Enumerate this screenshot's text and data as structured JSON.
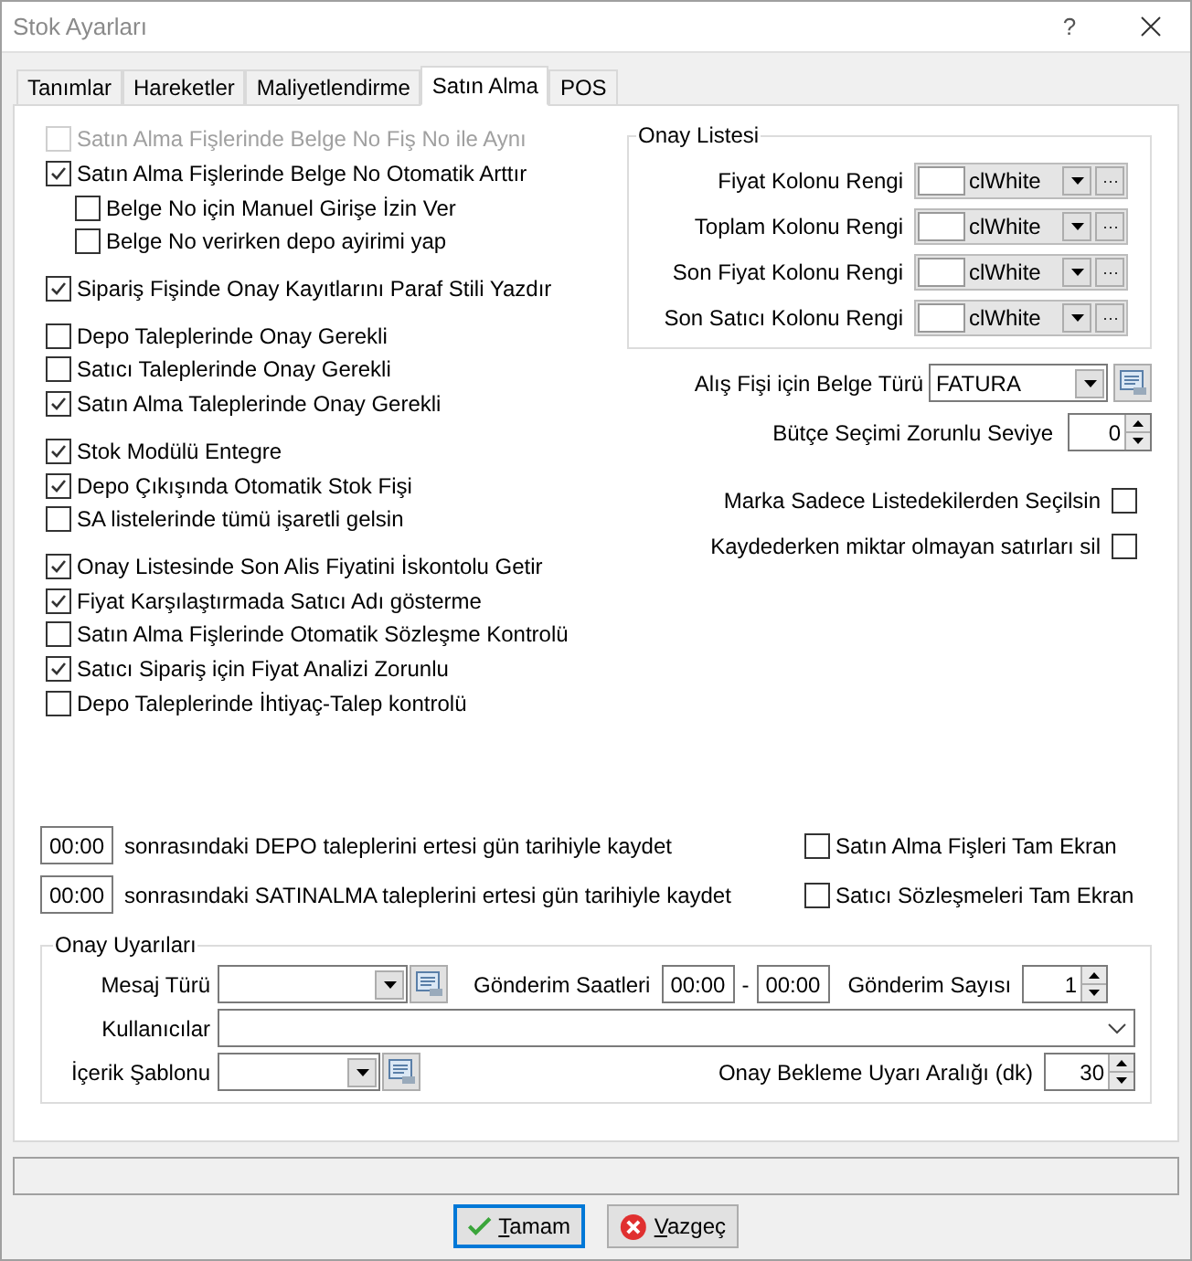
{
  "window": {
    "title": "Stok Ayarları",
    "help": "?"
  },
  "tabs": [
    {
      "label": "Tanımlar",
      "selected": false
    },
    {
      "label": "Hareketler",
      "selected": false
    },
    {
      "label": "Maliyetlendirme",
      "selected": false
    },
    {
      "label": "Satın Alma",
      "selected": true
    },
    {
      "label": "POS",
      "selected": false
    }
  ],
  "left_options": [
    [
      {
        "label": "Satın Alma Fişlerinde Belge No Fiş No ile Aynı",
        "checked": false,
        "disabled": true
      },
      {
        "label": "Satın Alma Fişlerinde Belge No Otomatik Arttır",
        "checked": true,
        "disabled": false,
        "children": [
          {
            "label": "Belge No için Manuel Girişe İzin Ver",
            "checked": false,
            "disabled": false
          },
          {
            "label": "Belge No verirken depo ayirimi yap",
            "checked": false,
            "disabled": false
          }
        ]
      }
    ],
    [
      {
        "label": "Sipariş Fişinde Onay Kayıtlarını Paraf Stili Yazdır",
        "checked": true,
        "disabled": false
      }
    ],
    [
      {
        "label": "Depo Taleplerinde Onay Gerekli",
        "checked": false,
        "disabled": false
      },
      {
        "label": "Satıcı Taleplerinde Onay Gerekli",
        "checked": false,
        "disabled": false
      },
      {
        "label": "Satın Alma Taleplerinde Onay Gerekli",
        "checked": true,
        "disabled": false
      }
    ],
    [
      {
        "label": "Stok Modülü Entegre",
        "checked": true,
        "disabled": false
      },
      {
        "label": "Depo Çıkışında Otomatik Stok Fişi",
        "checked": true,
        "disabled": false
      },
      {
        "label": "SA listelerinde tümü işaretli gelsin",
        "checked": false,
        "disabled": false
      }
    ],
    [
      {
        "label": "Onay Listesinde Son Alis Fiyatini İskontolu Getir",
        "checked": true,
        "disabled": false
      },
      {
        "label": "Fiyat Karşılaştırmada Satıcı Adı gösterme",
        "checked": true,
        "disabled": false
      },
      {
        "label": "Satın Alma Fişlerinde Otomatik Sözleşme Kontrolü",
        "checked": false,
        "disabled": false
      },
      {
        "label": "Satıcı Sipariş için Fiyat Analizi Zorunlu",
        "checked": true,
        "disabled": false
      },
      {
        "label": "Depo Taleplerinde İhtiyaç-Talep kontrolü",
        "checked": false,
        "disabled": false
      }
    ]
  ],
  "onay_listesi": {
    "title": "Onay Listesi",
    "rows": [
      {
        "label": "Fiyat Kolonu Rengi",
        "color": "#ffffff",
        "value": "clWhite"
      },
      {
        "label": "Toplam Kolonu Rengi",
        "color": "#ffffff",
        "value": "clWhite"
      },
      {
        "label": "Son Fiyat Kolonu Rengi",
        "color": "#ffffff",
        "value": "clWhite"
      },
      {
        "label": "Son Satıcı Kolonu Rengi",
        "color": "#ffffff",
        "value": "clWhite"
      }
    ]
  },
  "belge_turu": {
    "label": "Alış Fişi için Belge Türü",
    "value": "FATURA"
  },
  "butce": {
    "label": "Bütçe Seçimi Zorunlu Seviye",
    "value": "0"
  },
  "right_checks": [
    {
      "label": "Marka Sadece Listedekilerden Seçilsin",
      "checked": false
    },
    {
      "label": "Kaydederken miktar olmayan satırları sil",
      "checked": false
    }
  ],
  "time_rules": [
    {
      "time": "00:00",
      "label": "sonrasındaki DEPO taleplerini ertesi gün tarihiyle kaydet"
    },
    {
      "time": "00:00",
      "label": "sonrasındaki SATINALMA taleplerini ertesi gün tarihiyle kaydet"
    }
  ],
  "fullscreen_checks": [
    {
      "label": "Satın Alma Fişleri Tam Ekran",
      "checked": false
    },
    {
      "label": "Satıcı Sözleşmeleri Tam Ekran",
      "checked": false
    }
  ],
  "onay_uyarilari": {
    "title": "Onay Uyarıları",
    "mesaj_turu": {
      "label": "Mesaj Türü"
    },
    "gonderim_saatleri": {
      "label": "Gönderim Saatleri",
      "from": "00:00",
      "separator": "-",
      "to": "00:00"
    },
    "gonderim_sayisi": {
      "label": "Gönderim Sayısı",
      "value": "1"
    },
    "kullanicilar": {
      "label": "Kullanıcılar"
    },
    "icerik_sablonu": {
      "label": "İçerik Şablonu"
    },
    "bekleme": {
      "label": "Onay Bekleme Uyarı Aralığı (dk)",
      "value": "30"
    }
  },
  "buttons": [
    {
      "label": "Tamam",
      "kind": "ok"
    },
    {
      "label": "Vazgeç",
      "kind": "cancel"
    }
  ]
}
